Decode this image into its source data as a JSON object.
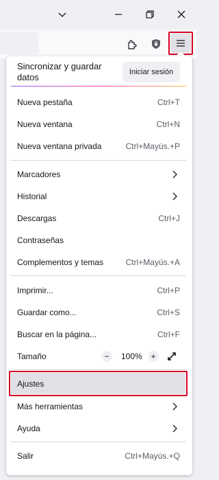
{
  "menu": {
    "sync": {
      "text": "Sincronizar y guardar datos",
      "signin_label": "Iniciar sesión"
    },
    "group1": [
      {
        "label": "Nueva pestaña",
        "shortcut": "Ctrl+T"
      },
      {
        "label": "Nueva ventana",
        "shortcut": "Ctrl+N"
      },
      {
        "label": "Nueva ventana privada",
        "shortcut": "Ctrl+Mayús.+P"
      }
    ],
    "group2": [
      {
        "label": "Marcadores"
      },
      {
        "label": "Historial"
      },
      {
        "label": "Descargas",
        "shortcut": "Ctrl+J"
      },
      {
        "label": "Contraseñas"
      },
      {
        "label": "Complementos y temas",
        "shortcut": "Ctrl+Mayús.+A"
      }
    ],
    "group3": [
      {
        "label": "Imprimir...",
        "shortcut": "Ctrl+P"
      },
      {
        "label": "Guardar como...",
        "shortcut": "Ctrl+S"
      },
      {
        "label": "Buscar en la página...",
        "shortcut": "Ctrl+F"
      }
    ],
    "zoom": {
      "label": "Tamaño",
      "minus": "−",
      "value": "100%",
      "plus": "+"
    },
    "group4": [
      {
        "label": "Ajustes"
      },
      {
        "label": "Más herramientas"
      },
      {
        "label": "Ayuda"
      }
    ],
    "group5": [
      {
        "label": "Salir",
        "shortcut": "Ctrl+Mayús.+Q"
      }
    ]
  },
  "icons": {
    "titlebar": [
      "chevron-down-icon",
      "minimize-icon",
      "restore-icon",
      "close-icon"
    ],
    "toolbar": [
      "extensions-icon",
      "shield-icon",
      "hamburger-menu-icon"
    ]
  },
  "colors": {
    "highlight_border": "#d70022",
    "selected_bg": "#e0e0e6",
    "accent_gradient": [
      "#9059ff",
      "#ff4aa2",
      "#ffbd4f"
    ]
  }
}
